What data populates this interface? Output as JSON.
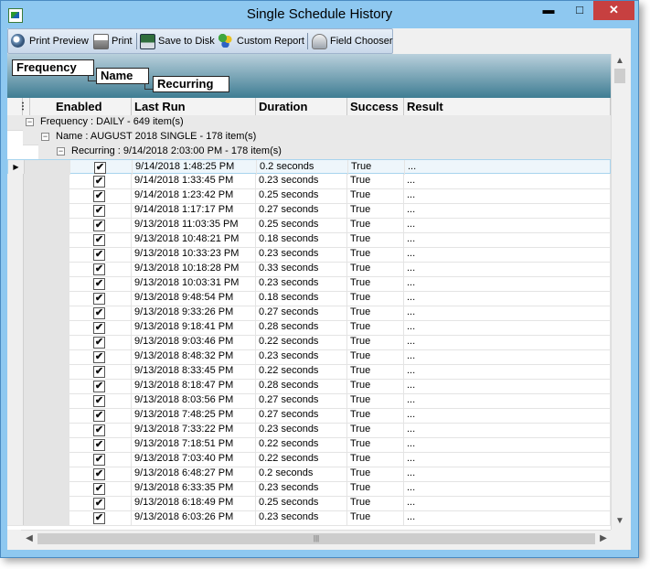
{
  "window": {
    "title": "Single Schedule History",
    "minimize_glyph": "▬",
    "maximize_glyph": "□",
    "close_glyph": "✕"
  },
  "toolbar": {
    "print_preview": "Print Preview",
    "print": "Print",
    "save_to_disk": "Save to Disk",
    "custom_report": "Custom Report",
    "field_chooser": "Field Chooser"
  },
  "group_by": {
    "level1": "Frequency",
    "level2": "Name",
    "level3": "Recurring"
  },
  "columns": [
    "Enabled",
    "Last Run",
    "Duration",
    "Success",
    "Result"
  ],
  "groups": {
    "frequency": "Frequency : DAILY - 649 item(s)",
    "name": "Name : AUGUST 2018 SINGLE - 178 item(s)",
    "recurring": "Recurring : 9/14/2018 2:03:00 PM - 178 item(s)",
    "toggle_glyph": "−"
  },
  "row_selector_glyph": "▶",
  "check_glyph": "✔",
  "rows": [
    {
      "enabled": true,
      "last_run": "9/14/2018 1:48:25 PM",
      "duration": "0.2 seconds",
      "success": "True",
      "result": "..."
    },
    {
      "enabled": true,
      "last_run": "9/14/2018 1:33:45 PM",
      "duration": "0.23 seconds",
      "success": "True",
      "result": "..."
    },
    {
      "enabled": true,
      "last_run": "9/14/2018 1:23:42 PM",
      "duration": "0.25 seconds",
      "success": "True",
      "result": "..."
    },
    {
      "enabled": true,
      "last_run": "9/14/2018 1:17:17 PM",
      "duration": "0.27 seconds",
      "success": "True",
      "result": "..."
    },
    {
      "enabled": true,
      "last_run": "9/13/2018 11:03:35 PM",
      "duration": "0.25 seconds",
      "success": "True",
      "result": "..."
    },
    {
      "enabled": true,
      "last_run": "9/13/2018 10:48:21 PM",
      "duration": "0.18 seconds",
      "success": "True",
      "result": "..."
    },
    {
      "enabled": true,
      "last_run": "9/13/2018 10:33:23 PM",
      "duration": "0.23 seconds",
      "success": "True",
      "result": "..."
    },
    {
      "enabled": true,
      "last_run": "9/13/2018 10:18:28 PM",
      "duration": "0.33 seconds",
      "success": "True",
      "result": "..."
    },
    {
      "enabled": true,
      "last_run": "9/13/2018 10:03:31 PM",
      "duration": "0.23 seconds",
      "success": "True",
      "result": "..."
    },
    {
      "enabled": true,
      "last_run": "9/13/2018 9:48:54 PM",
      "duration": "0.18 seconds",
      "success": "True",
      "result": "..."
    },
    {
      "enabled": true,
      "last_run": "9/13/2018 9:33:26 PM",
      "duration": "0.27 seconds",
      "success": "True",
      "result": "..."
    },
    {
      "enabled": true,
      "last_run": "9/13/2018 9:18:41 PM",
      "duration": "0.28 seconds",
      "success": "True",
      "result": "..."
    },
    {
      "enabled": true,
      "last_run": "9/13/2018 9:03:46 PM",
      "duration": "0.22 seconds",
      "success": "True",
      "result": "..."
    },
    {
      "enabled": true,
      "last_run": "9/13/2018 8:48:32 PM",
      "duration": "0.23 seconds",
      "success": "True",
      "result": "..."
    },
    {
      "enabled": true,
      "last_run": "9/13/2018 8:33:45 PM",
      "duration": "0.22 seconds",
      "success": "True",
      "result": "..."
    },
    {
      "enabled": true,
      "last_run": "9/13/2018 8:18:47 PM",
      "duration": "0.28 seconds",
      "success": "True",
      "result": "..."
    },
    {
      "enabled": true,
      "last_run": "9/13/2018 8:03:56 PM",
      "duration": "0.27 seconds",
      "success": "True",
      "result": "..."
    },
    {
      "enabled": true,
      "last_run": "9/13/2018 7:48:25 PM",
      "duration": "0.27 seconds",
      "success": "True",
      "result": "..."
    },
    {
      "enabled": true,
      "last_run": "9/13/2018 7:33:22 PM",
      "duration": "0.23 seconds",
      "success": "True",
      "result": "..."
    },
    {
      "enabled": true,
      "last_run": "9/13/2018 7:18:51 PM",
      "duration": "0.22 seconds",
      "success": "True",
      "result": "..."
    },
    {
      "enabled": true,
      "last_run": "9/13/2018 7:03:40 PM",
      "duration": "0.22 seconds",
      "success": "True",
      "result": "..."
    },
    {
      "enabled": true,
      "last_run": "9/13/2018 6:48:27 PM",
      "duration": "0.2 seconds",
      "success": "True",
      "result": "..."
    },
    {
      "enabled": true,
      "last_run": "9/13/2018 6:33:35 PM",
      "duration": "0.23 seconds",
      "success": "True",
      "result": "..."
    },
    {
      "enabled": true,
      "last_run": "9/13/2018 6:18:49 PM",
      "duration": "0.25 seconds",
      "success": "True",
      "result": "..."
    },
    {
      "enabled": true,
      "last_run": "9/13/2018 6:03:26 PM",
      "duration": "0.23 seconds",
      "success": "True",
      "result": "..."
    }
  ],
  "scroll": {
    "up": "▲",
    "down": "▼",
    "left": "◀",
    "right": "▶",
    "grip": "|||"
  },
  "colors": {
    "titlebar": "#8ec8f0",
    "close_button": "#c74040",
    "group_band_top": "#b9d0dc",
    "group_band_bottom": "#3f7d93",
    "current_row": "#eef6fb"
  }
}
